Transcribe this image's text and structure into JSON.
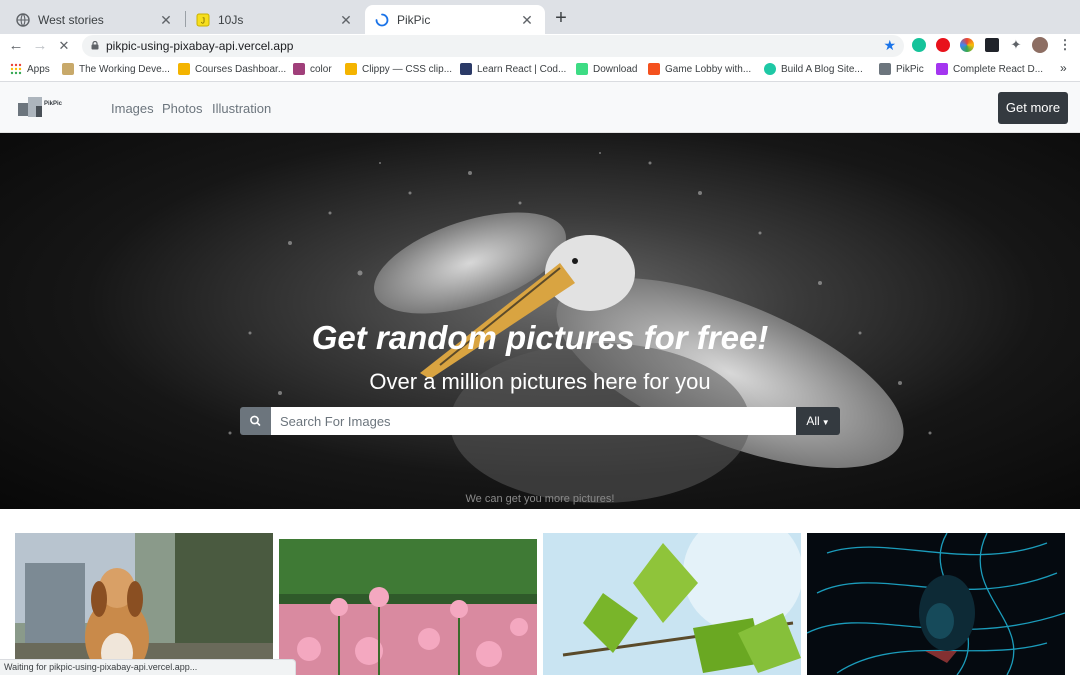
{
  "browser": {
    "tabs": [
      {
        "title": "West stories",
        "icon": "globe-icon"
      },
      {
        "title": "10Js",
        "icon": "yellow-folder-icon"
      },
      {
        "title": "PikPic",
        "icon": "loading-spinner-icon"
      }
    ],
    "active_tab": 2,
    "url": "pikpic-using-pixabay-api.vercel.app",
    "bookmarks": [
      {
        "label": "Apps",
        "icon": "apps-grid-icon",
        "color": "#ea4335"
      },
      {
        "label": "The Working Deve...",
        "icon": "dev-icon",
        "color": "#c8a96a"
      },
      {
        "label": "Courses Dashboar...",
        "icon": "crown-icon",
        "color": "#f4b400"
      },
      {
        "label": "color",
        "icon": "color-swatch-icon",
        "color": "#a03f7a"
      },
      {
        "label": "Clippy — CSS clip...",
        "icon": "clippy-icon",
        "color": "#f4b400"
      },
      {
        "label": "Learn React | Cod...",
        "icon": "scrimba-icon",
        "color": "#2b3a67"
      },
      {
        "label": "Download",
        "icon": "android-icon",
        "color": "#3ddc84"
      },
      {
        "label": "Game Lobby with...",
        "icon": "flame-icon",
        "color": "#f4511e"
      },
      {
        "label": "Build A Blog Site...",
        "icon": "blog-icon",
        "color": "#1ec8a5"
      },
      {
        "label": "PikPic",
        "icon": "pikpic-icon",
        "color": "#6c757d"
      },
      {
        "label": "Complete React D...",
        "icon": "udemy-icon",
        "color": "#a435f0"
      }
    ],
    "bookmarks_overflow": "»",
    "status_text": "Waiting for pikpic-using-pixabay-api.vercel.app..."
  },
  "site": {
    "logo_text": "PikPic",
    "nav": [
      "Images",
      "Photos",
      "Illustration"
    ],
    "cta": "Get more"
  },
  "hero": {
    "title": "Get random pictures for free!",
    "subtitle": "Over a million pictures here for you",
    "search_placeholder": "Search For Images",
    "category_select": "All",
    "footer_note": "We can get you more pictures!"
  },
  "gallery": [
    {
      "subject": "dog"
    },
    {
      "subject": "pink poppy flowers"
    },
    {
      "subject": "green leaves"
    },
    {
      "subject": "light-painted portrait"
    }
  ]
}
